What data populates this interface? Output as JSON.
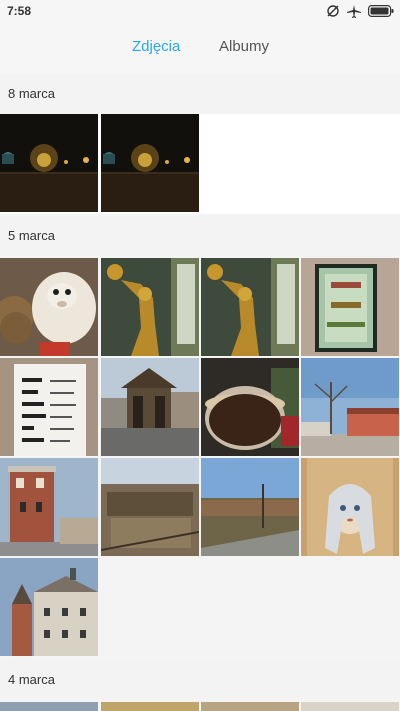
{
  "status": {
    "time": "7:58"
  },
  "tabs": {
    "photos": "Zdjęcia",
    "albums": "Albumy"
  },
  "sections": [
    {
      "date": "8 marca"
    },
    {
      "date": "5 marca"
    },
    {
      "date": "4 marca"
    }
  ],
  "colors": {
    "accent": "#2aa7e6"
  }
}
